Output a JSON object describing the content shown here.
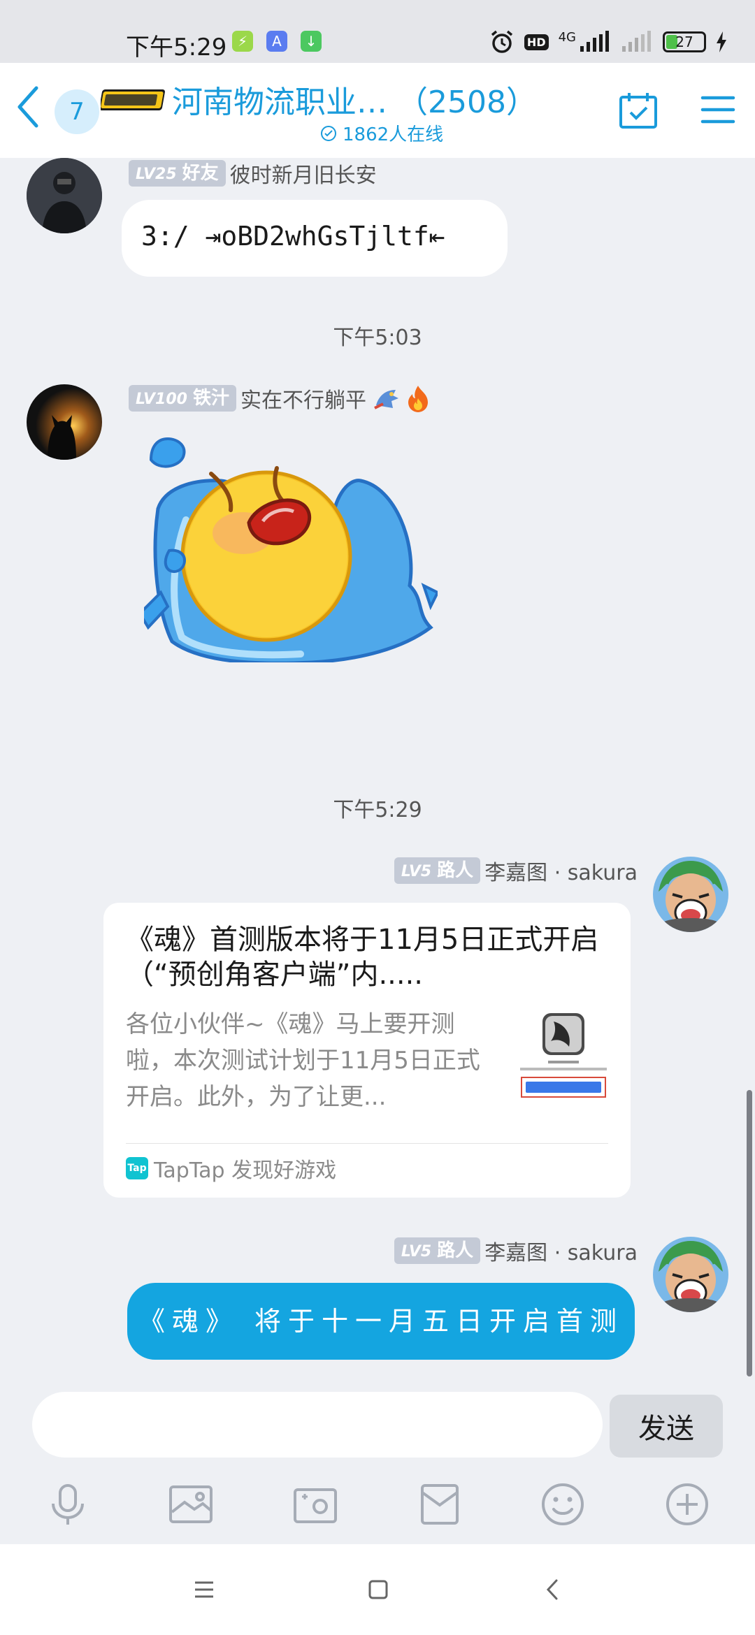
{
  "status_bar": {
    "time": "下午5:29",
    "network": "4G",
    "hd": "HD",
    "battery": "27"
  },
  "header": {
    "unread_count": "7",
    "title": "河南物流职业…  （2508）",
    "online": "1862人在线"
  },
  "messages": [
    {
      "level": "LV25",
      "rank": "好友",
      "sender": "彼时新月旧长安",
      "text": "3:/ ⇥oBD2whGsTjltf⇤"
    },
    {
      "time": "下午5:03"
    },
    {
      "level": "LV100",
      "rank": "铁汁",
      "sender": "实在不行躺平",
      "sticker": "crying-face"
    },
    {
      "time": "下午5:29"
    },
    {
      "level": "LV5",
      "rank": "路人",
      "sender": "李嘉图 · sakura",
      "card": {
        "title": "《魂》首测版本将于11月5日正式开启（“预创角客户端”内.....",
        "description": "各位小伙伴~《魂》马上要开测啦，本次测试计划于11月5日正式开启。此外，为了让更...",
        "source": "TapTap 发现好游戏",
        "source_icon_text": "Tap"
      }
    },
    {
      "level": "LV5",
      "rank": "路人",
      "sender": "李嘉图 · sakura",
      "text": "《魂》 将于十一月五日开启首测"
    }
  ],
  "input": {
    "send_label": "发送"
  },
  "toolbar": [
    "mic-icon",
    "image-icon",
    "camera-icon",
    "file-icon",
    "emoji-icon",
    "plus-icon"
  ],
  "colors": {
    "accent": "#1a9bdb",
    "outgoing_bubble": "#14a5e0",
    "background": "#eef0f4"
  }
}
